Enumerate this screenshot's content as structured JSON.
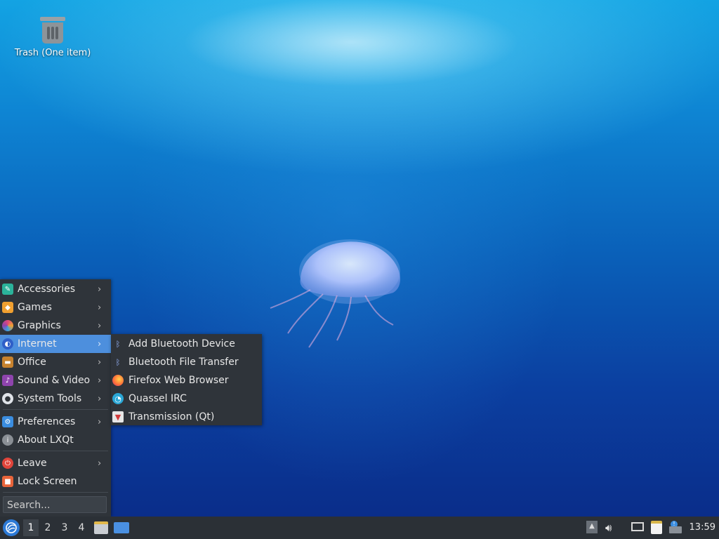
{
  "desktop": {
    "icons": [
      {
        "label": "Trash (One item)",
        "icon": "trash-icon"
      }
    ]
  },
  "menu": {
    "items": [
      {
        "label": "Accessories",
        "icon": "accessories-icon",
        "color": "#2bb39a",
        "submenu": true
      },
      {
        "label": "Games",
        "icon": "games-icon",
        "color": "#f0a030",
        "submenu": true
      },
      {
        "label": "Graphics",
        "icon": "graphics-icon",
        "color": "#e0487a",
        "submenu": true
      },
      {
        "label": "Internet",
        "icon": "internet-icon",
        "color": "#3a78e0",
        "submenu": true,
        "active": true
      },
      {
        "label": "Office",
        "icon": "office-icon",
        "color": "#c7822e",
        "submenu": true
      },
      {
        "label": "Sound & Video",
        "icon": "sound-video-icon",
        "color": "#8e44ad",
        "submenu": true
      },
      {
        "label": "System Tools",
        "icon": "system-tools-icon",
        "color": "#dfe3e8",
        "submenu": true
      },
      {
        "label": "Preferences",
        "icon": "preferences-icon",
        "color": "#3a8de0",
        "submenu": true
      },
      {
        "label": "About LXQt",
        "icon": "info-icon",
        "color": "#8a8f95",
        "submenu": false
      },
      {
        "label": "Leave",
        "icon": "power-icon",
        "color": "#e0443a",
        "submenu": true
      },
      {
        "label": "Lock Screen",
        "icon": "lock-icon",
        "color": "#e8643a",
        "submenu": false
      }
    ],
    "search_placeholder": "Search..."
  },
  "internet_submenu": {
    "items": [
      {
        "label": "Add Bluetooth Device",
        "icon": "bluetooth-icon"
      },
      {
        "label": "Bluetooth File Transfer",
        "icon": "bluetooth-icon"
      },
      {
        "label": "Firefox Web Browser",
        "icon": "firefox-icon"
      },
      {
        "label": "Quassel IRC",
        "icon": "quassel-icon"
      },
      {
        "label": "Transmission (Qt)",
        "icon": "transmission-icon"
      }
    ]
  },
  "taskbar": {
    "desktops": [
      "1",
      "2",
      "3",
      "4"
    ],
    "current_desktop": "1",
    "clock": "13:59"
  }
}
